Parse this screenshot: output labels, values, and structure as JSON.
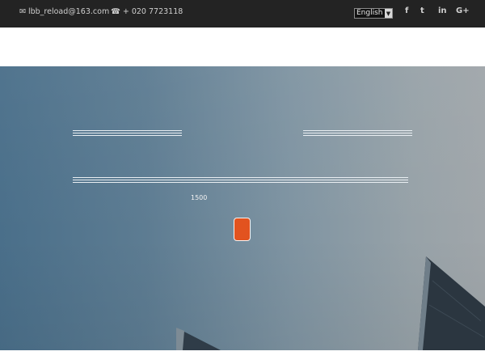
{
  "topbar": {
    "email": "lbb_reload@163.com",
    "phone": "+ 020 7723118",
    "language": {
      "selected": "English"
    },
    "social": {
      "facebook": "f",
      "twitter": "t",
      "linkedin": "in",
      "google_plus": "G+"
    }
  },
  "hero": {
    "number": "1500"
  },
  "colors": {
    "topbar_bg": "#232323",
    "accent_button": "#e2531f",
    "hero_sky_left": "#4a6f8a",
    "hero_sky_right": "#a0a6aa"
  },
  "icons": {
    "email": "envelope-icon",
    "phone": "phone-icon",
    "language_dropdown": "chevron-down-icon",
    "facebook": "facebook-icon",
    "twitter": "twitter-icon",
    "linkedin": "linkedin-icon",
    "google_plus": "google-plus-icon"
  }
}
